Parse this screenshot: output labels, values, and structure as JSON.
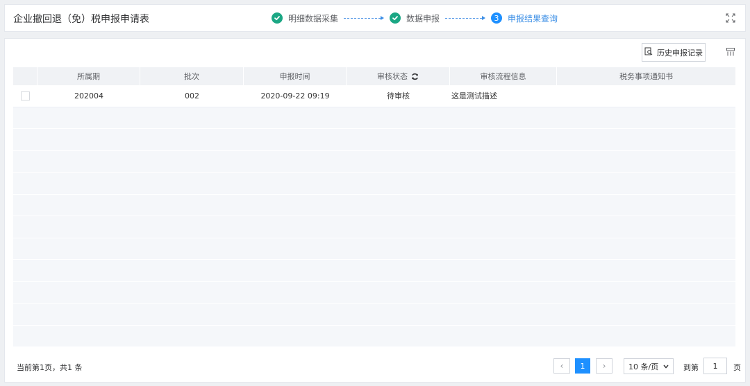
{
  "header": {
    "title": "企业撤回退（免）税申报申请表",
    "steps": [
      {
        "label": "明细数据采集",
        "status": "done"
      },
      {
        "label": "数据申报",
        "status": "done"
      },
      {
        "number": "3",
        "label": "申报结果查询",
        "status": "active"
      }
    ],
    "fullscreen_icon": "fullscreen-icon"
  },
  "toolbar": {
    "history_label": "历史申报记录",
    "history_icon": "search-document-icon",
    "column_settings_icon": "column-settings-icon"
  },
  "table": {
    "columns": [
      "",
      "所属期",
      "批次",
      "申报时间",
      "审核状态",
      "审核流程信息",
      "税务事项通知书"
    ],
    "refresh_icon": "refresh-icon",
    "rows": [
      {
        "period": "202004",
        "batch": "002",
        "time": "2020-09-22 09:19",
        "status": "待审核",
        "flow": "这是测试描述",
        "notice": ""
      }
    ]
  },
  "footer": {
    "summary": "当前第1页，共1 条",
    "current_page": "1",
    "page_size": "10 条/页",
    "goto_label": "到第",
    "goto_value": "1",
    "goto_suffix": "页"
  },
  "colors": {
    "accent": "#1e90ff",
    "done": "#1ba784"
  }
}
